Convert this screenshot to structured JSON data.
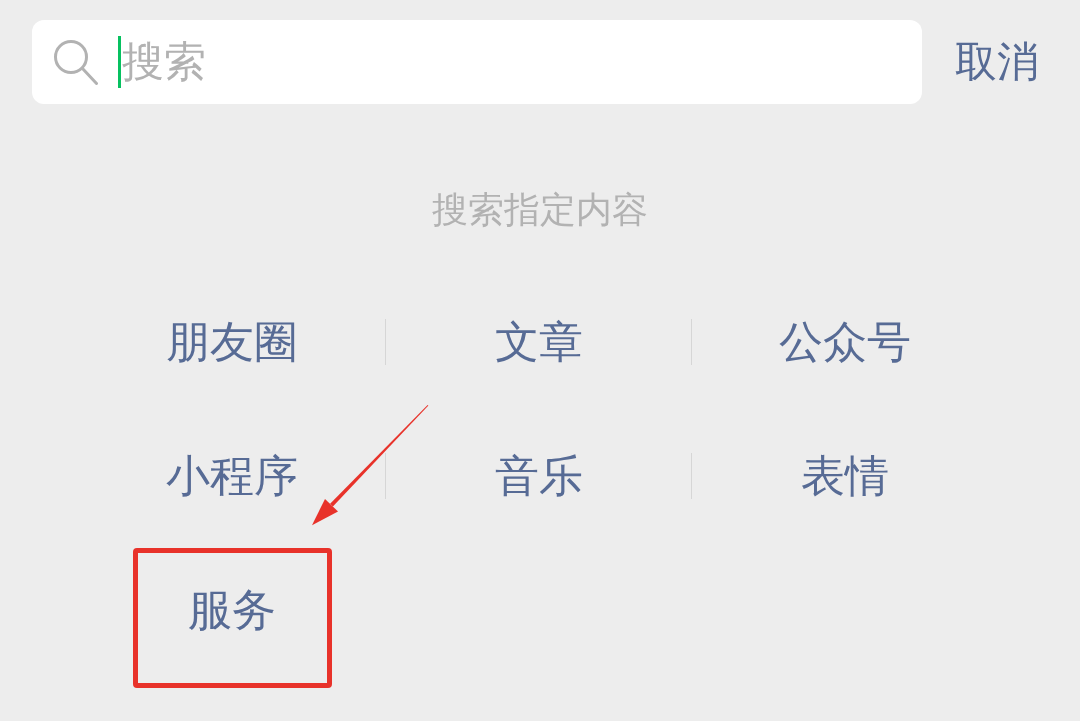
{
  "search_bar": {
    "placeholder": "搜索",
    "focused": true
  },
  "cancel_button": "取消",
  "section_title": "搜索指定内容",
  "categories": [
    {
      "label": "朋友圈",
      "highlighted": false
    },
    {
      "label": "文章",
      "highlighted": false
    },
    {
      "label": "公众号",
      "highlighted": false
    },
    {
      "label": "小程序",
      "highlighted": false
    },
    {
      "label": "音乐",
      "highlighted": false
    },
    {
      "label": "表情",
      "highlighted": false
    },
    {
      "label": "服务",
      "highlighted": true
    }
  ]
}
